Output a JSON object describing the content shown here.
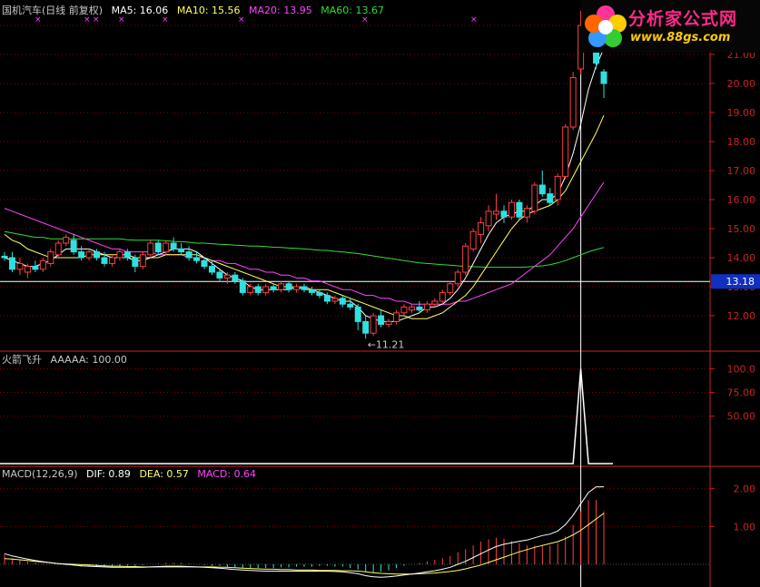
{
  "header": {
    "title": "国机汽车(日线 前复权)",
    "ma": [
      {
        "label": "MA5: 16.06",
        "color": "#ffffff"
      },
      {
        "label": "MA10: 15.56",
        "color": "#ffff66"
      },
      {
        "label": "MA20: 13.95",
        "color": "#ff44ff"
      },
      {
        "label": "MA60: 13.67",
        "color": "#33dd33"
      }
    ]
  },
  "logo": {
    "title": "分析家公式网",
    "url": "www.88gs.com"
  },
  "colors": {
    "up": "#ff4040",
    "down": "#30e0e0",
    "grid": "#8b0000",
    "axis": "#cc2222"
  },
  "chart_data": [
    {
      "type": "candlestick",
      "axis_ticks": [
        "12.00",
        "13.00",
        "14.00",
        "15.00",
        "16.00",
        "17.00",
        "18.00",
        "19.00",
        "20.00",
        "21.00",
        "22.00"
      ],
      "ylim": [
        11.0,
        22.5
      ],
      "price_marker": 13.18,
      "price_marker_label": "13.18",
      "low_annotation": {
        "value": 11.21,
        "label": "←11.21"
      },
      "candles": [
        [
          14.05,
          14.2,
          13.9,
          14.0
        ],
        [
          14.0,
          14.2,
          13.5,
          13.6
        ],
        [
          13.6,
          14.0,
          13.4,
          13.8
        ],
        [
          13.5,
          13.8,
          13.3,
          13.7
        ],
        [
          13.7,
          13.9,
          13.5,
          13.6
        ],
        [
          13.6,
          14.0,
          13.5,
          13.9
        ],
        [
          13.8,
          14.3,
          13.7,
          14.2
        ],
        [
          14.1,
          14.6,
          14.0,
          14.5
        ],
        [
          14.5,
          14.8,
          14.4,
          14.7
        ],
        [
          14.6,
          14.8,
          14.1,
          14.2
        ],
        [
          14.2,
          14.4,
          13.9,
          14.0
        ],
        [
          14.0,
          14.3,
          13.9,
          14.2
        ],
        [
          14.2,
          14.3,
          13.9,
          14.0
        ],
        [
          14.0,
          14.2,
          13.7,
          13.8
        ],
        [
          13.8,
          14.1,
          13.7,
          14.0
        ],
        [
          14.0,
          14.3,
          13.9,
          14.2
        ],
        [
          14.2,
          14.3,
          13.9,
          14.0
        ],
        [
          14.0,
          14.1,
          13.5,
          13.7
        ],
        [
          13.7,
          14.2,
          13.6,
          14.1
        ],
        [
          14.1,
          14.6,
          14.0,
          14.5
        ],
        [
          14.5,
          14.6,
          14.1,
          14.2
        ],
        [
          14.2,
          14.6,
          14.1,
          14.5
        ],
        [
          14.5,
          14.7,
          14.2,
          14.3
        ],
        [
          14.3,
          14.5,
          14.1,
          14.2
        ],
        [
          14.2,
          14.4,
          13.9,
          14.0
        ],
        [
          14.0,
          14.2,
          13.8,
          13.9
        ],
        [
          13.9,
          14.0,
          13.6,
          13.7
        ],
        [
          13.7,
          13.9,
          13.4,
          13.5
        ],
        [
          13.5,
          13.6,
          13.2,
          13.3
        ],
        [
          13.3,
          13.5,
          13.1,
          13.4
        ],
        [
          13.4,
          13.5,
          13.1,
          13.2
        ],
        [
          13.2,
          13.3,
          12.7,
          12.8
        ],
        [
          12.8,
          13.1,
          12.7,
          13.0
        ],
        [
          13.0,
          13.1,
          12.7,
          12.8
        ],
        [
          12.8,
          13.1,
          12.7,
          13.0
        ],
        [
          13.0,
          13.1,
          12.8,
          12.9
        ],
        [
          12.9,
          13.2,
          12.8,
          13.1
        ],
        [
          13.1,
          13.2,
          12.8,
          12.9
        ],
        [
          12.9,
          13.1,
          12.8,
          13.0
        ],
        [
          13.0,
          13.1,
          12.8,
          12.9
        ],
        [
          12.9,
          13.0,
          12.7,
          12.8
        ],
        [
          12.8,
          12.9,
          12.6,
          12.7
        ],
        [
          12.7,
          12.8,
          12.4,
          12.5
        ],
        [
          12.5,
          12.7,
          12.4,
          12.6
        ],
        [
          12.6,
          12.7,
          12.3,
          12.4
        ],
        [
          12.4,
          12.6,
          12.2,
          12.3
        ],
        [
          12.3,
          12.4,
          11.5,
          11.8
        ],
        [
          11.8,
          12.0,
          11.21,
          11.4
        ],
        [
          11.4,
          12.1,
          11.3,
          12.0
        ],
        [
          12.0,
          12.2,
          11.6,
          11.7
        ],
        [
          11.7,
          11.9,
          11.6,
          11.8
        ],
        [
          11.8,
          12.2,
          11.7,
          12.1
        ],
        [
          12.1,
          12.4,
          12.0,
          12.3
        ],
        [
          12.2,
          12.4,
          12.1,
          12.3
        ],
        [
          12.3,
          12.5,
          12.1,
          12.2
        ],
        [
          12.2,
          12.5,
          12.1,
          12.4
        ],
        [
          12.4,
          12.6,
          12.3,
          12.5
        ],
        [
          12.5,
          12.9,
          12.4,
          12.8
        ],
        [
          12.8,
          13.2,
          12.7,
          13.1
        ],
        [
          13.1,
          13.6,
          13.0,
          13.5
        ],
        [
          13.5,
          14.5,
          13.4,
          14.4
        ],
        [
          14.3,
          15.0,
          14.2,
          14.9
        ],
        [
          14.8,
          15.4,
          14.5,
          15.2
        ],
        [
          15.1,
          15.8,
          14.9,
          15.6
        ],
        [
          15.5,
          16.2,
          15.3,
          15.6
        ],
        [
          15.6,
          15.8,
          15.2,
          15.4
        ],
        [
          15.4,
          16.0,
          15.3,
          15.9
        ],
        [
          15.9,
          16.0,
          15.3,
          15.4
        ],
        [
          15.4,
          15.8,
          15.2,
          15.7
        ],
        [
          15.6,
          16.6,
          15.5,
          16.5
        ],
        [
          16.5,
          17.0,
          16.1,
          16.2
        ],
        [
          16.2,
          16.4,
          15.8,
          15.9
        ],
        [
          16.0,
          16.9,
          15.8,
          16.8
        ],
        [
          16.8,
          18.6,
          16.7,
          18.5
        ],
        [
          18.5,
          20.4,
          18.4,
          20.2
        ],
        [
          20.5,
          22.5,
          20.3,
          22.0
        ],
        [
          22.5,
          22.8,
          21.6,
          21.8
        ],
        [
          21.8,
          22.3,
          20.5,
          20.7
        ],
        [
          20.4,
          20.5,
          19.5,
          20.0
        ]
      ],
      "ma5": [
        14.0,
        13.9,
        13.8,
        13.7,
        13.7,
        13.8,
        13.9,
        14.1,
        14.3,
        14.3,
        14.3,
        14.3,
        14.2,
        14.1,
        14.0,
        14.0,
        14.0,
        13.9,
        13.9,
        14.0,
        14.1,
        14.2,
        14.3,
        14.3,
        14.3,
        14.2,
        14.0,
        13.8,
        13.6,
        13.4,
        13.3,
        13.2,
        13.0,
        12.9,
        12.9,
        12.9,
        12.9,
        12.9,
        13.0,
        12.9,
        12.9,
        12.8,
        12.7,
        12.6,
        12.5,
        12.5,
        12.3,
        12.0,
        11.9,
        11.8,
        11.8,
        11.8,
        11.9,
        12.0,
        12.1,
        12.3,
        12.3,
        12.4,
        12.6,
        12.9,
        13.3,
        13.8,
        14.3,
        14.8,
        15.2,
        15.4,
        15.5,
        15.6,
        15.6,
        15.8,
        16.0,
        16.0,
        16.2,
        16.8,
        17.6,
        18.6,
        19.8,
        20.6,
        21.2
      ],
      "ma10": [
        14.8,
        14.6,
        14.5,
        14.3,
        14.2,
        14.1,
        14.0,
        14.0,
        14.0,
        14.0,
        14.0,
        14.1,
        14.1,
        14.1,
        14.1,
        14.1,
        14.1,
        14.0,
        14.0,
        14.0,
        14.0,
        14.1,
        14.1,
        14.1,
        14.1,
        14.1,
        14.0,
        13.9,
        13.8,
        13.7,
        13.6,
        13.5,
        13.4,
        13.3,
        13.2,
        13.1,
        13.0,
        13.0,
        13.0,
        13.0,
        12.9,
        12.9,
        12.9,
        12.8,
        12.7,
        12.6,
        12.5,
        12.4,
        12.3,
        12.2,
        12.1,
        12.0,
        12.0,
        11.9,
        11.9,
        11.9,
        12.0,
        12.1,
        12.3,
        12.5,
        12.7,
        13.0,
        13.4,
        13.8,
        14.2,
        14.6,
        15.0,
        15.3,
        15.5,
        15.6,
        15.7,
        15.8,
        16.0,
        16.3,
        16.8,
        17.3,
        17.8,
        18.3,
        18.9
      ],
      "ma20": [
        15.7,
        15.6,
        15.5,
        15.4,
        15.3,
        15.2,
        15.1,
        15.0,
        14.9,
        14.8,
        14.7,
        14.6,
        14.5,
        14.4,
        14.3,
        14.3,
        14.2,
        14.2,
        14.2,
        14.2,
        14.1,
        14.1,
        14.1,
        14.1,
        14.0,
        14.0,
        14.0,
        13.9,
        13.9,
        13.8,
        13.8,
        13.7,
        13.6,
        13.6,
        13.5,
        13.5,
        13.4,
        13.4,
        13.3,
        13.3,
        13.2,
        13.2,
        13.1,
        13.0,
        12.9,
        12.9,
        12.8,
        12.7,
        12.7,
        12.6,
        12.6,
        12.5,
        12.5,
        12.4,
        12.4,
        12.4,
        12.4,
        12.4,
        12.4,
        12.5,
        12.5,
        12.6,
        12.7,
        12.8,
        12.9,
        13.0,
        13.1,
        13.3,
        13.5,
        13.7,
        13.9,
        14.1,
        14.4,
        14.7,
        15.0,
        15.4,
        15.8,
        16.2,
        16.6
      ],
      "ma60": [
        14.9,
        14.85,
        14.8,
        14.75,
        14.7,
        14.7,
        14.65,
        14.65,
        14.65,
        14.65,
        14.65,
        14.65,
        14.65,
        14.65,
        14.65,
        14.65,
        14.62,
        14.6,
        14.6,
        14.6,
        14.6,
        14.58,
        14.56,
        14.55,
        14.53,
        14.5,
        14.5,
        14.48,
        14.46,
        14.45,
        14.43,
        14.42,
        14.4,
        14.4,
        14.38,
        14.36,
        14.35,
        14.33,
        14.32,
        14.3,
        14.28,
        14.26,
        14.25,
        14.22,
        14.2,
        14.17,
        14.14,
        14.1,
        14.06,
        14.02,
        13.98,
        13.94,
        13.9,
        13.86,
        13.82,
        13.8,
        13.78,
        13.76,
        13.74,
        13.72,
        13.7,
        13.69,
        13.68,
        13.67,
        13.67,
        13.67,
        13.67,
        13.67,
        13.68,
        13.7,
        13.72,
        13.76,
        13.82,
        13.9,
        14.0,
        14.1,
        14.2,
        14.28,
        14.35
      ]
    },
    {
      "type": "line",
      "title": "火箭飞升",
      "legend": "AAAAA: 100.00",
      "axis_ticks": [
        "50.00",
        "75.00",
        "100.0"
      ],
      "ylim": [
        0,
        110
      ],
      "spike_index": 75,
      "spike_value": 100
    },
    {
      "type": "bar",
      "title": "MACD(12,26,9)",
      "legend": [
        {
          "label": "DIF: 0.89",
          "color": "#ffffff"
        },
        {
          "label": "DEA: 0.57",
          "color": "#ffff66"
        },
        {
          "label": "MACD: 0.64",
          "color": "#ff44ff"
        }
      ],
      "axis_ticks": [
        "1.00",
        "2.00"
      ],
      "ylim": [
        -0.6,
        2.4
      ],
      "dif": [
        0.28,
        0.22,
        0.18,
        0.14,
        0.1,
        0.07,
        0.04,
        0.02,
        0.0,
        -0.02,
        -0.04,
        -0.05,
        -0.06,
        -0.07,
        -0.08,
        -0.08,
        -0.08,
        -0.08,
        -0.08,
        -0.07,
        -0.06,
        -0.05,
        -0.05,
        -0.05,
        -0.06,
        -0.07,
        -0.08,
        -0.09,
        -0.1,
        -0.12,
        -0.14,
        -0.15,
        -0.16,
        -0.17,
        -0.18,
        -0.18,
        -0.18,
        -0.18,
        -0.18,
        -0.18,
        -0.18,
        -0.18,
        -0.18,
        -0.19,
        -0.2,
        -0.22,
        -0.25,
        -0.3,
        -0.33,
        -0.34,
        -0.33,
        -0.31,
        -0.28,
        -0.26,
        -0.23,
        -0.2,
        -0.17,
        -0.13,
        -0.08,
        0.0,
        0.08,
        0.18,
        0.28,
        0.38,
        0.47,
        0.53,
        0.57,
        0.61,
        0.64,
        0.7,
        0.76,
        0.8,
        0.88,
        1.05,
        1.3,
        1.6,
        1.9,
        2.05,
        2.05
      ],
      "dea": [
        0.15,
        0.14,
        0.12,
        0.1,
        0.08,
        0.06,
        0.04,
        0.02,
        0.01,
        0.0,
        -0.01,
        -0.02,
        -0.03,
        -0.04,
        -0.05,
        -0.05,
        -0.06,
        -0.06,
        -0.07,
        -0.07,
        -0.07,
        -0.07,
        -0.07,
        -0.07,
        -0.07,
        -0.07,
        -0.07,
        -0.07,
        -0.08,
        -0.08,
        -0.09,
        -0.1,
        -0.11,
        -0.12,
        -0.13,
        -0.13,
        -0.14,
        -0.14,
        -0.15,
        -0.15,
        -0.15,
        -0.16,
        -0.16,
        -0.16,
        -0.17,
        -0.17,
        -0.18,
        -0.2,
        -0.22,
        -0.24,
        -0.25,
        -0.26,
        -0.26,
        -0.26,
        -0.25,
        -0.24,
        -0.23,
        -0.21,
        -0.19,
        -0.16,
        -0.12,
        -0.07,
        -0.02,
        0.05,
        0.12,
        0.19,
        0.26,
        0.33,
        0.39,
        0.45,
        0.5,
        0.55,
        0.6,
        0.68,
        0.78,
        0.9,
        1.05,
        1.2,
        1.35
      ],
      "macd_hist": [
        0.26,
        0.16,
        0.12,
        0.08,
        0.04,
        0.02,
        0.0,
        0.0,
        -0.02,
        -0.04,
        -0.06,
        -0.06,
        -0.06,
        -0.06,
        -0.06,
        -0.06,
        -0.04,
        -0.04,
        -0.02,
        0.0,
        0.02,
        0.04,
        0.04,
        0.04,
        0.02,
        0.0,
        -0.02,
        -0.04,
        -0.04,
        -0.08,
        -0.1,
        -0.1,
        -0.1,
        -0.1,
        -0.1,
        -0.1,
        -0.08,
        -0.08,
        -0.06,
        -0.06,
        -0.06,
        -0.04,
        -0.04,
        -0.06,
        -0.06,
        -0.1,
        -0.14,
        -0.2,
        -0.22,
        -0.2,
        -0.16,
        -0.1,
        -0.04,
        0.0,
        0.04,
        0.08,
        0.12,
        0.16,
        0.22,
        0.32,
        0.4,
        0.5,
        0.6,
        0.66,
        0.7,
        0.68,
        0.62,
        0.56,
        0.5,
        0.5,
        0.52,
        0.5,
        0.56,
        0.74,
        1.04,
        1.4,
        1.7,
        1.7,
        1.4
      ]
    }
  ]
}
